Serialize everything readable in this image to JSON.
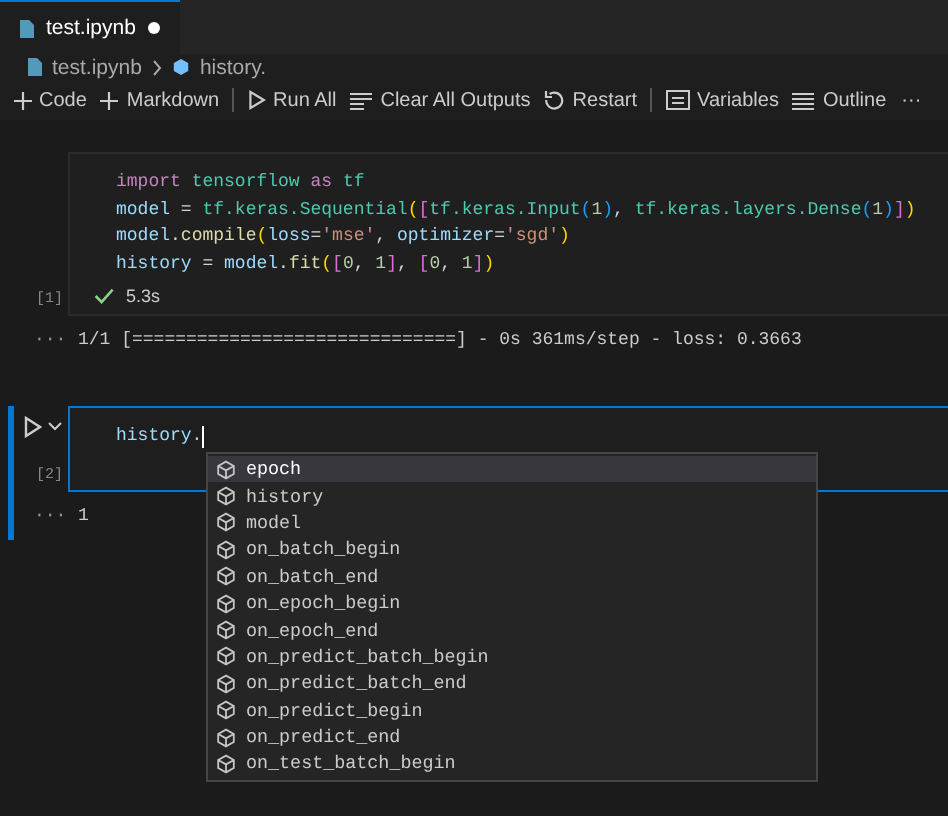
{
  "tabs": [
    {
      "label": "test.ipynb",
      "modified": true,
      "selected": true
    }
  ],
  "breadcrumb": [
    {
      "label": "test.ipynb",
      "kind": "file"
    },
    {
      "label": "history.",
      "kind": "symbol"
    }
  ],
  "toolbar": [
    {
      "kind": "add",
      "label": "Code"
    },
    {
      "kind": "add",
      "label": "Markdown"
    },
    {
      "kind": "separator"
    },
    {
      "kind": "run",
      "label": "Run All"
    },
    {
      "kind": "clear",
      "label": "Clear All Outputs"
    },
    {
      "kind": "restart",
      "label": "Restart"
    },
    {
      "kind": "separator"
    },
    {
      "kind": "variables",
      "label": "Variables"
    },
    {
      "kind": "outline",
      "label": "Outline"
    },
    {
      "kind": "more",
      "label": "···"
    }
  ],
  "cells": [
    {
      "focused": false,
      "execution_count": "[1]",
      "status": {
        "success": true,
        "time": "5.3s"
      },
      "code": [
        [
          {
            "text": "import ",
            "kind": "kw"
          },
          {
            "text": "tensorflow ",
            "kind": "mod"
          },
          {
            "text": "as ",
            "kind": "kw"
          },
          {
            "text": "tf",
            "kind": "mod"
          }
        ],
        [
          {
            "text": "model",
            "kind": "var"
          },
          {
            "text": " = ",
            "kind": "op"
          },
          {
            "text": "tf.keras.Sequential",
            "kind": "mod"
          },
          {
            "text": "(",
            "kind": "b1"
          },
          {
            "text": "[",
            "kind": "b2"
          },
          {
            "text": "tf.keras.Input",
            "kind": "mod"
          },
          {
            "text": "(",
            "kind": "b3"
          },
          {
            "text": "1",
            "kind": "num"
          },
          {
            "text": ")",
            "kind": "b3"
          },
          {
            "text": ", ",
            "kind": "op"
          },
          {
            "text": "tf.keras.layers.Dense",
            "kind": "mod"
          },
          {
            "text": "(",
            "kind": "b3"
          },
          {
            "text": "1",
            "kind": "num"
          },
          {
            "text": ")",
            "kind": "b3"
          },
          {
            "text": "]",
            "kind": "b2"
          },
          {
            "text": ")",
            "kind": "b1"
          }
        ],
        [
          {
            "text": "model",
            "kind": "var"
          },
          {
            "text": ".",
            "kind": "op"
          },
          {
            "text": "compile",
            "kind": "func"
          },
          {
            "text": "(",
            "kind": "b1"
          },
          {
            "text": "loss",
            "kind": "var"
          },
          {
            "text": "=",
            "kind": "op"
          },
          {
            "text": "'mse'",
            "kind": "str"
          },
          {
            "text": ", ",
            "kind": "op"
          },
          {
            "text": "optimizer",
            "kind": "var"
          },
          {
            "text": "=",
            "kind": "op"
          },
          {
            "text": "'sgd'",
            "kind": "str"
          },
          {
            "text": ")",
            "kind": "b1"
          }
        ],
        [
          {
            "text": "history",
            "kind": "var"
          },
          {
            "text": " = ",
            "kind": "op"
          },
          {
            "text": "model",
            "kind": "var"
          },
          {
            "text": ".",
            "kind": "op"
          },
          {
            "text": "fit",
            "kind": "func"
          },
          {
            "text": "(",
            "kind": "b1"
          },
          {
            "text": "[",
            "kind": "b2"
          },
          {
            "text": "0",
            "kind": "num"
          },
          {
            "text": ", ",
            "kind": "op"
          },
          {
            "text": "1",
            "kind": "num"
          },
          {
            "text": "]",
            "kind": "b2"
          },
          {
            "text": ", ",
            "kind": "op"
          },
          {
            "text": "[",
            "kind": "b2"
          },
          {
            "text": "0",
            "kind": "num"
          },
          {
            "text": ", ",
            "kind": "op"
          },
          {
            "text": "1",
            "kind": "num"
          },
          {
            "text": "]",
            "kind": "b2"
          },
          {
            "text": ")",
            "kind": "b1"
          }
        ]
      ],
      "output": {
        "marker": "···",
        "text": "1/1 [==============================] - 0s 361ms/step - loss: 0.3663"
      }
    },
    {
      "focused": true,
      "execution_count": "[2]",
      "code": [
        [
          {
            "text": "history.",
            "kind": "var"
          }
        ]
      ],
      "output": {
        "marker": "···",
        "text": "1"
      }
    }
  ],
  "suggestions": [
    {
      "label": "epoch",
      "selected": true
    },
    {
      "label": "history",
      "selected": false
    },
    {
      "label": "model",
      "selected": false
    },
    {
      "label": "on_batch_begin",
      "selected": false
    },
    {
      "label": "on_batch_end",
      "selected": false
    },
    {
      "label": "on_epoch_begin",
      "selected": false
    },
    {
      "label": "on_epoch_end",
      "selected": false
    },
    {
      "label": "on_predict_batch_begin",
      "selected": false
    },
    {
      "label": "on_predict_batch_end",
      "selected": false
    },
    {
      "label": "on_predict_begin",
      "selected": false
    },
    {
      "label": "on_predict_end",
      "selected": false
    },
    {
      "label": "on_test_batch_begin",
      "selected": false
    }
  ]
}
